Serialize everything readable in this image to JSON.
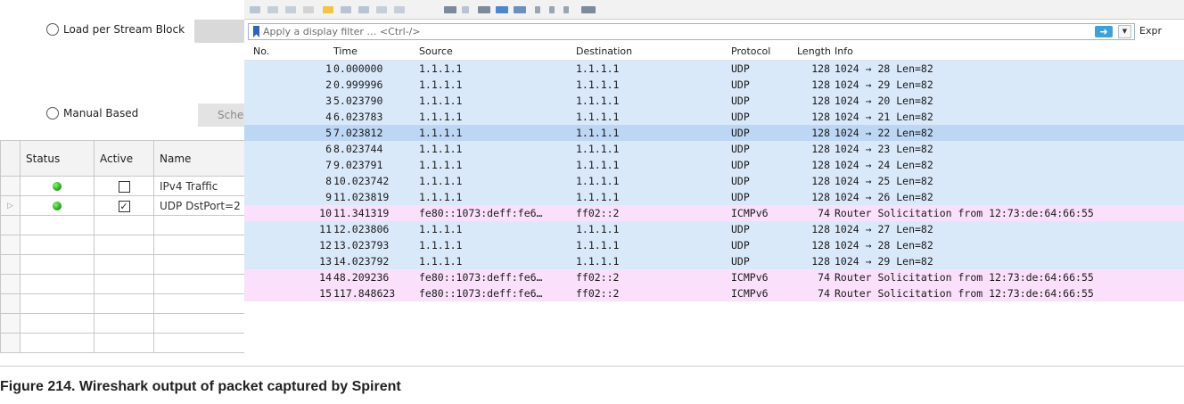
{
  "spirent": {
    "radio_load": "Load per Stream Block",
    "radio_manual": "Manual Based",
    "schedule_button": "Sche",
    "table": {
      "headers": {
        "status": "Status",
        "active": "Active",
        "name": "Name"
      },
      "rows": [
        {
          "status": "green",
          "active": false,
          "name": "IPv4 Traffic",
          "selected": false
        },
        {
          "status": "green",
          "active": true,
          "name": "UDP DstPort=2",
          "selected": true
        }
      ],
      "empty_rows": 7
    }
  },
  "wireshark": {
    "filter": {
      "placeholder": "Apply a display filter … <Ctrl-/>",
      "expression_label": "Expr"
    },
    "columns": {
      "no": "No.",
      "time": "Time",
      "source": "Source",
      "destination": "Destination",
      "protocol": "Protocol",
      "length": "Length",
      "info": "Info"
    },
    "colors": {
      "udp_row": "#dae9fa",
      "udp_row_selected": "#bcd6f4",
      "icmpv6_row": "#fbe0fb"
    },
    "packets": [
      {
        "no": "1",
        "time": "0.000000",
        "source": "1.1.1.1",
        "destination": "1.1.1.1",
        "protocol": "UDP",
        "length": "128",
        "info": "1024 → 28 Len=82"
      },
      {
        "no": "2",
        "time": "0.999996",
        "source": "1.1.1.1",
        "destination": "1.1.1.1",
        "protocol": "UDP",
        "length": "128",
        "info": "1024 → 29 Len=82"
      },
      {
        "no": "3",
        "time": "5.023790",
        "source": "1.1.1.1",
        "destination": "1.1.1.1",
        "protocol": "UDP",
        "length": "128",
        "info": "1024 → 20 Len=82"
      },
      {
        "no": "4",
        "time": "6.023783",
        "source": "1.1.1.1",
        "destination": "1.1.1.1",
        "protocol": "UDP",
        "length": "128",
        "info": "1024 → 21 Len=82"
      },
      {
        "no": "5",
        "time": "7.023812",
        "source": "1.1.1.1",
        "destination": "1.1.1.1",
        "protocol": "UDP",
        "length": "128",
        "info": "1024 → 22 Len=82",
        "selected": true
      },
      {
        "no": "6",
        "time": "8.023744",
        "source": "1.1.1.1",
        "destination": "1.1.1.1",
        "protocol": "UDP",
        "length": "128",
        "info": "1024 → 23 Len=82"
      },
      {
        "no": "7",
        "time": "9.023791",
        "source": "1.1.1.1",
        "destination": "1.1.1.1",
        "protocol": "UDP",
        "length": "128",
        "info": "1024 → 24 Len=82"
      },
      {
        "no": "8",
        "time": "10.023742",
        "source": "1.1.1.1",
        "destination": "1.1.1.1",
        "protocol": "UDP",
        "length": "128",
        "info": "1024 → 25 Len=82"
      },
      {
        "no": "9",
        "time": "11.023819",
        "source": "1.1.1.1",
        "destination": "1.1.1.1",
        "protocol": "UDP",
        "length": "128",
        "info": "1024 → 26 Len=82"
      },
      {
        "no": "10",
        "time": "11.341319",
        "source": "fe80::1073:deff:fe6…",
        "destination": "ff02::2",
        "protocol": "ICMPv6",
        "length": "74",
        "info": "Router Solicitation from 12:73:de:64:66:55"
      },
      {
        "no": "11",
        "time": "12.023806",
        "source": "1.1.1.1",
        "destination": "1.1.1.1",
        "protocol": "UDP",
        "length": "128",
        "info": "1024 → 27 Len=82"
      },
      {
        "no": "12",
        "time": "13.023793",
        "source": "1.1.1.1",
        "destination": "1.1.1.1",
        "protocol": "UDP",
        "length": "128",
        "info": "1024 → 28 Len=82"
      },
      {
        "no": "13",
        "time": "14.023792",
        "source": "1.1.1.1",
        "destination": "1.1.1.1",
        "protocol": "UDP",
        "length": "128",
        "info": "1024 → 29 Len=82"
      },
      {
        "no": "14",
        "time": "48.209236",
        "source": "fe80::1073:deff:fe6…",
        "destination": "ff02::2",
        "protocol": "ICMPv6",
        "length": "74",
        "info": "Router Solicitation from 12:73:de:64:66:55"
      },
      {
        "no": "15",
        "time": "117.848623",
        "source": "fe80::1073:deff:fe6…",
        "destination": "ff02::2",
        "protocol": "ICMPv6",
        "length": "74",
        "info": "Router Solicitation from 12:73:de:64:66:55"
      }
    ]
  },
  "caption": "Figure 214.  Wireshark output of packet captured by Spirent"
}
